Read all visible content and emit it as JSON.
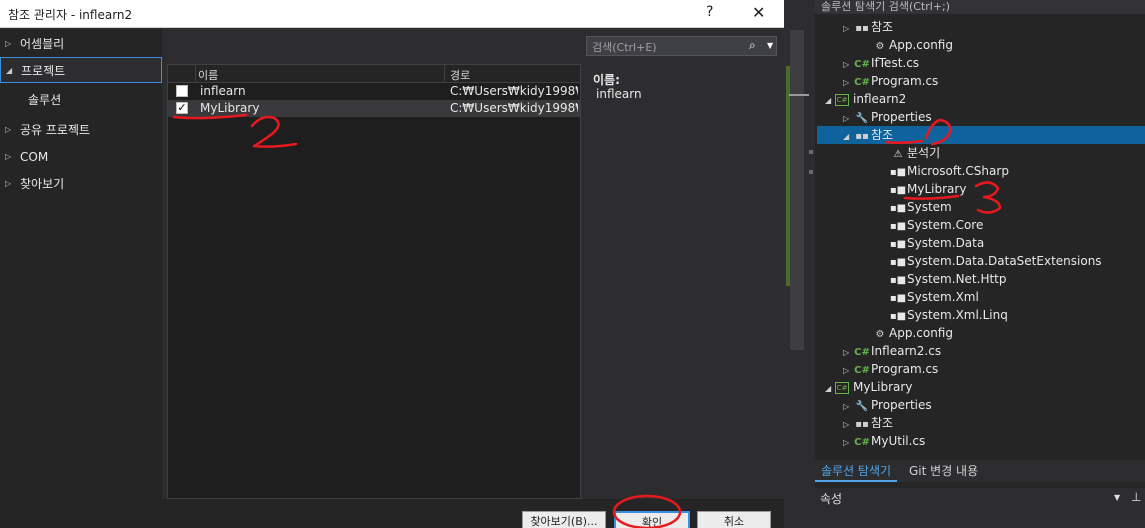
{
  "dialog": {
    "title": "참조 관리자 - inflearn2",
    "help_icon": "?",
    "close_icon": "✕",
    "nav": [
      {
        "label": "어셈블리",
        "arrow": "▷"
      },
      {
        "label": "프로젝트",
        "arrow": "◢"
      },
      {
        "label": "솔루션",
        "arrow": ""
      },
      {
        "label": "공유 프로젝트",
        "arrow": "▷"
      },
      {
        "label": "COM",
        "arrow": "▷"
      },
      {
        "label": "찾아보기",
        "arrow": "▷"
      }
    ],
    "columns": {
      "name": "이름",
      "path": "경로"
    },
    "rows": [
      {
        "name": "inflearn",
        "path": "C:₩Users₩kidy1998₩...",
        "checked": ""
      },
      {
        "name": "MyLibrary",
        "path": "C:₩Users₩kidy1998₩...",
        "checked": "✓"
      }
    ],
    "search_placeholder": "검색(Ctrl+E)",
    "detail_label": "이름:",
    "detail_value": "inflearn",
    "buttons": {
      "browse": "찾아보기(B)...",
      "ok": "확인",
      "cancel": "취소"
    }
  },
  "explorer": {
    "search_placeholder": "솔루션 탐색기 검색(Ctrl+;)",
    "tree": [
      {
        "label": "참조",
        "twist": "▷",
        "icon": "ref"
      },
      {
        "label": "App.config",
        "twist": "",
        "icon": "cfg"
      },
      {
        "label": "IfTest.cs",
        "twist": "▷",
        "icon": "cs"
      },
      {
        "label": "Program.cs",
        "twist": "▷",
        "icon": "cs"
      },
      {
        "label": "inflearn2",
        "twist": "◢",
        "icon": "proj"
      },
      {
        "label": "Properties",
        "twist": "▷",
        "icon": "wrench"
      },
      {
        "label": "참조",
        "twist": "◢",
        "icon": "ref"
      },
      {
        "label": "분석기",
        "twist": "",
        "icon": "analyzer"
      },
      {
        "label": "Microsoft.CSharp",
        "twist": "",
        "icon": "asm"
      },
      {
        "label": "MyLibrary",
        "twist": "",
        "icon": "asm"
      },
      {
        "label": "System",
        "twist": "",
        "icon": "asm"
      },
      {
        "label": "System.Core",
        "twist": "",
        "icon": "asm"
      },
      {
        "label": "System.Data",
        "twist": "",
        "icon": "asm"
      },
      {
        "label": "System.Data.DataSetExtensions",
        "twist": "",
        "icon": "asm"
      },
      {
        "label": "System.Net.Http",
        "twist": "",
        "icon": "asm"
      },
      {
        "label": "System.Xml",
        "twist": "",
        "icon": "asm"
      },
      {
        "label": "System.Xml.Linq",
        "twist": "",
        "icon": "asm"
      },
      {
        "label": "App.config",
        "twist": "",
        "icon": "cfg"
      },
      {
        "label": "Inflearn2.cs",
        "twist": "▷",
        "icon": "cs"
      },
      {
        "label": "Program.cs",
        "twist": "▷",
        "icon": "cs"
      },
      {
        "label": "MyLibrary",
        "twist": "◢",
        "icon": "proj"
      },
      {
        "label": "Properties",
        "twist": "▷",
        "icon": "wrench"
      },
      {
        "label": "참조",
        "twist": "▷",
        "icon": "ref"
      },
      {
        "label": "MyUtil.cs",
        "twist": "▷",
        "icon": "cs"
      }
    ],
    "icons": {
      "cs": "C#",
      "ref": "▪▪",
      "asm": "▪■",
      "cfg": "⚙",
      "wrench": "🔧",
      "analyzer": "⚠",
      "proj": "C#"
    },
    "tabs": {
      "solution": "솔루션 탐색기",
      "git": "Git 변경 내용"
    },
    "props_title": "속성",
    "props_menu": "▼",
    "props_pin": "⊥"
  },
  "colors": {
    "accent": "#0e639c",
    "annotation_red": "#e8191e",
    "cs_green": "#68b04d"
  }
}
